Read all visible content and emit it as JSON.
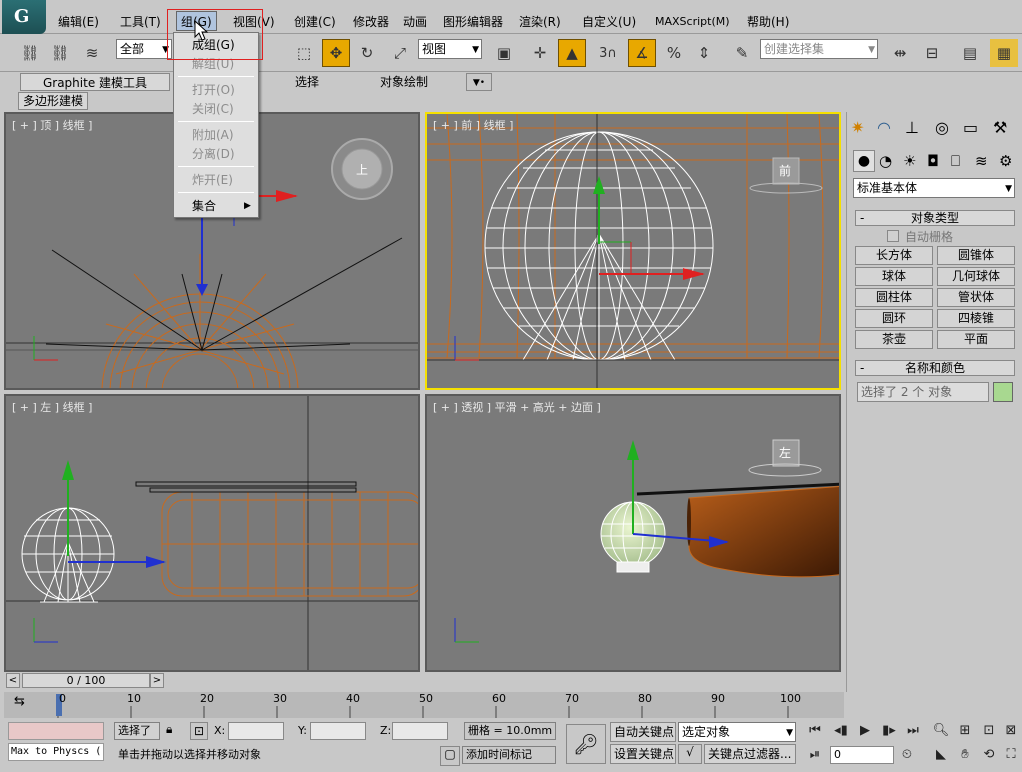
{
  "menubar": {
    "items": [
      "编辑(E)",
      "工具(T)",
      "组(G)",
      "视图(V)",
      "创建(C)",
      "修改器",
      "动画",
      "图形编辑器",
      "渲染(R)",
      "自定义(U)",
      "MAXScript(M)",
      "帮助(H)"
    ]
  },
  "toolbar": {
    "selection_filter": "全部",
    "ref_coord": "视图",
    "named_selection_placeholder": "创建选择集",
    "snap_label": "3"
  },
  "ribbon": {
    "tabs": [
      "Graphite 建模工具",
      "选择",
      "对象绘制"
    ],
    "mode_label": "多边形建模"
  },
  "group_menu": {
    "items": [
      {
        "label": "成组(G)",
        "enabled": true
      },
      {
        "label": "解组(U)",
        "enabled": false
      },
      {
        "label": "打开(O)",
        "enabled": false
      },
      {
        "label": "关闭(C)",
        "enabled": false
      },
      {
        "label": "附加(A)",
        "enabled": false
      },
      {
        "label": "分离(D)",
        "enabled": false
      },
      {
        "label": "炸开(E)",
        "enabled": false
      },
      {
        "label": "集合",
        "enabled": true
      }
    ]
  },
  "viewports": {
    "top": {
      "label": "[ + ] 顶 ] 线框 ]",
      "cube_label": "上"
    },
    "front": {
      "label": "[ + ] 前 ] 线框 ]",
      "cube_label": "前"
    },
    "left": {
      "label": "[ + ] 左 ] 线框 ]"
    },
    "perspective": {
      "label": "[ + ] 透视 ] 平滑 + 高光 + 边面 ]",
      "cube_label": "左"
    }
  },
  "timeline": {
    "frame_display": "0 / 100",
    "ticks": [
      "0",
      "10",
      "20",
      "30",
      "40",
      "50",
      "60",
      "70",
      "80",
      "90",
      "100"
    ]
  },
  "status": {
    "maxscript_listener": "Max to Physcs (",
    "selection_text": "选择了",
    "x_label": "X:",
    "y_label": "Y:",
    "z_label": "Z:",
    "grid_text": "栅格 = 10.0mm",
    "prompt_text": "单击并拖动以选择并移动对象",
    "add_time_tag": "添加时间标记",
    "auto_key": "自动关键点",
    "set_key": "设置关键点",
    "key_mode": "选定对象",
    "key_filter": "关键点过滤器...",
    "current_frame": "0"
  },
  "command_panel": {
    "category": "标准基本体",
    "object_type_title": "对象类型",
    "auto_grid": "自动栅格",
    "buttons": [
      "长方体",
      "圆锥体",
      "球体",
      "几何球体",
      "圆柱体",
      "管状体",
      "圆环",
      "四棱锥",
      "茶壶",
      "平面"
    ],
    "name_color_title": "名称和颜色",
    "name_field": "选择了 2 个 对象",
    "object_color": "#a8d890"
  },
  "colors": {
    "ui_gray": "#c8c8c8",
    "viewport_gray": "#7a7a7a",
    "active_border": "#f5e000",
    "wire_orange": "#c86a1e",
    "axis_red": "#e02020",
    "axis_green": "#20b020",
    "axis_blue": "#2030d0"
  }
}
